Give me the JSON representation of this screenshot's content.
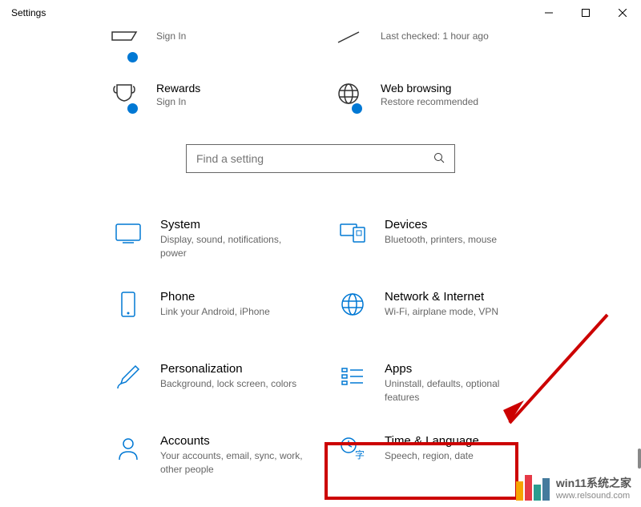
{
  "window": {
    "title": "Settings"
  },
  "top_tiles": {
    "cutoff_left": {
      "title": "",
      "sub": "Sign In"
    },
    "cutoff_right": {
      "title": "",
      "sub": "Last checked: 1 hour ago"
    },
    "rewards": {
      "title": "Rewards",
      "sub": "Sign In"
    },
    "web": {
      "title": "Web browsing",
      "sub": "Restore recommended"
    }
  },
  "search": {
    "placeholder": "Find a setting"
  },
  "categories": {
    "system": {
      "title": "System",
      "sub": "Display, sound, notifications, power"
    },
    "devices": {
      "title": "Devices",
      "sub": "Bluetooth, printers, mouse"
    },
    "phone": {
      "title": "Phone",
      "sub": "Link your Android, iPhone"
    },
    "network": {
      "title": "Network & Internet",
      "sub": "Wi-Fi, airplane mode, VPN"
    },
    "personalization": {
      "title": "Personalization",
      "sub": "Background, lock screen, colors"
    },
    "apps": {
      "title": "Apps",
      "sub": "Uninstall, defaults, optional features"
    },
    "accounts": {
      "title": "Accounts",
      "sub": "Your accounts, email, sync, work, other people"
    },
    "time": {
      "title": "Time & Language",
      "sub": "Speech, region, date"
    }
  },
  "watermark": {
    "title": "win11系统之家",
    "url": "www.relsound.com"
  }
}
